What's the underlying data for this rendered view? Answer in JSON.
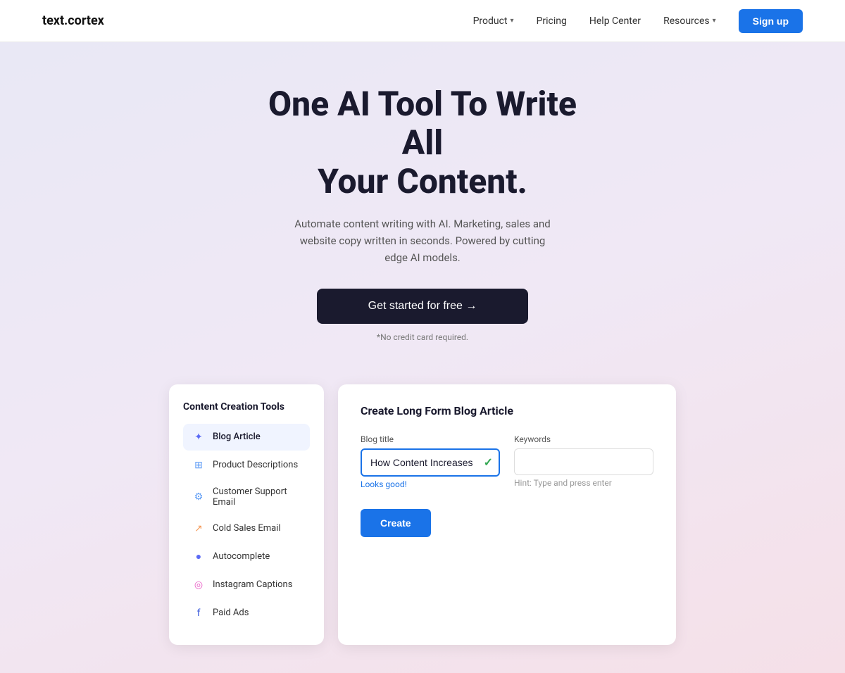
{
  "nav": {
    "logo": "text.cortex",
    "links": [
      {
        "label": "Product",
        "hasChevron": true
      },
      {
        "label": "Pricing",
        "hasChevron": false
      },
      {
        "label": "Help Center",
        "hasChevron": false
      },
      {
        "label": "Resources",
        "hasChevron": true
      }
    ],
    "signup_label": "Sign up"
  },
  "hero": {
    "headline_line1": "One AI Tool To Write All",
    "headline_line2": "Your Content.",
    "subtext": "Automate content writing with AI. Marketing, sales and website copy written in seconds. Powered by cutting edge AI models.",
    "cta_label": "Get started for free →",
    "no_cc_label": "*No credit card required."
  },
  "left_panel": {
    "title": "Content Creation Tools",
    "tools": [
      {
        "label": "Blog Article",
        "icon": "📝",
        "active": true
      },
      {
        "label": "Product Descriptions",
        "icon": "🛍️",
        "active": false
      },
      {
        "label": "Customer Support Email",
        "icon": "⚙️",
        "active": false
      },
      {
        "label": "Cold Sales Email",
        "icon": "📈",
        "active": false
      },
      {
        "label": "Autocomplete",
        "icon": "🔵",
        "active": false
      },
      {
        "label": "Instagram Captions",
        "icon": "📷",
        "active": false
      },
      {
        "label": "Paid Ads",
        "icon": "📘",
        "active": false
      }
    ]
  },
  "right_panel": {
    "title": "Create Long Form Blog Article",
    "blog_title_label": "Blog title",
    "blog_title_value": "How Content Increases Traffic",
    "blog_title_hint": "Looks good!",
    "keywords_label": "Keywords",
    "keywords_value": "",
    "keywords_hint": "Hint: Type and press enter",
    "create_label": "Create"
  }
}
